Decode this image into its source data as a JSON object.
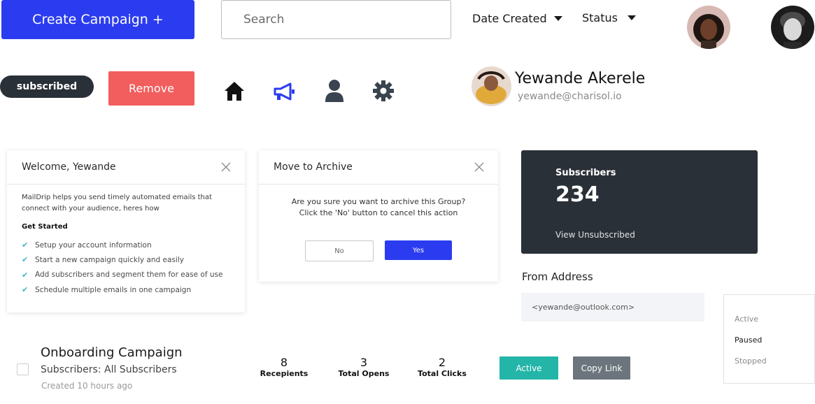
{
  "toolbar": {
    "create_label": "Create Campaign +",
    "search_placeholder": "Search",
    "sort_date_label": "Date Created",
    "status_filter_label": "Status"
  },
  "tag": {
    "label": "subscribed"
  },
  "actions": {
    "remove_label": "Remove"
  },
  "icons": [
    "home-icon",
    "megaphone-icon",
    "user-icon",
    "gear-icon"
  ],
  "profile": {
    "name": "Yewande Akerele",
    "email": "yewande@charisol.io"
  },
  "welcome_card": {
    "title": "Welcome, Yewande",
    "intro": "MailDrip helps you send timely automated emails that connect with your audience, heres how",
    "get_started": "Get Started",
    "steps": [
      "Setup your account information",
      "Start a new campaign quickly and easily",
      "Add subscribers and segment them for ease of use",
      "Schedule multiple emails in one campaign"
    ]
  },
  "archive_dialog": {
    "title": "Move to Archive",
    "line1": "Are you sure you want to archive this Group?",
    "line2": "Click the 'No' button to cancel this action",
    "no_label": "No",
    "yes_label": "Yes"
  },
  "subscribers_card": {
    "label": "Subscribers",
    "count": "234",
    "link": "View Unsubscribed"
  },
  "from_address": {
    "label": "From Address",
    "value": "<yewande@outlook.com>"
  },
  "status_menu": {
    "options": [
      "Active",
      "Paused",
      "Stopped"
    ],
    "selected": "Paused"
  },
  "campaign": {
    "title": "Onboarding Campaign",
    "subscribers": "Subscribers: All Subscribers",
    "created": "Created 10 hours ago",
    "stats": [
      {
        "value": "8",
        "label": "Recepients"
      },
      {
        "value": "3",
        "label": "Total Opens"
      },
      {
        "value": "2",
        "label": "Total Clicks"
      }
    ],
    "status_label": "Active",
    "copy_label": "Copy Link"
  },
  "colors": {
    "primary": "#2b3cf0",
    "danger": "#f25d5d",
    "dark": "#2a3038",
    "teal": "#24b5a9",
    "muted": "#6c757d"
  }
}
